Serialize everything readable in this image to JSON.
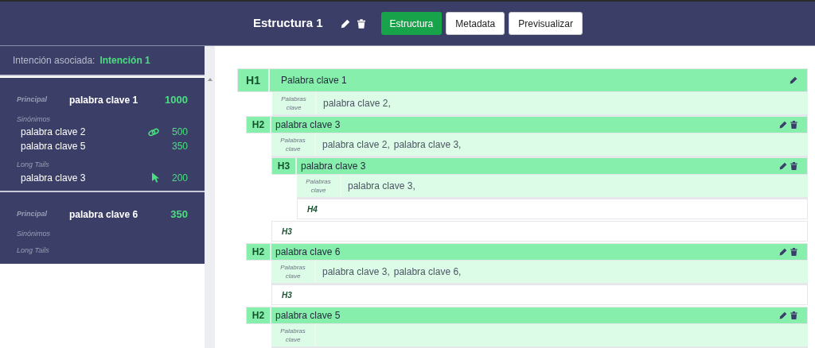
{
  "header": {
    "title": "Estructura 1",
    "tabs": [
      {
        "label": "Estructura",
        "selected": true
      },
      {
        "label": "Metadata",
        "selected": false
      },
      {
        "label": "Previsualizar",
        "selected": false
      }
    ]
  },
  "sidebar": {
    "intent_label": "Intención asociada:",
    "intent": "Intención 1",
    "groups": [
      {
        "principal_label": "Principal",
        "principal": "palabra clave 1",
        "volume": "1000",
        "synonyms_label": "Sinónimos",
        "synonyms": [
          {
            "text": "palabra clave 2",
            "volume": "500",
            "kind": "linked"
          },
          {
            "text": "palabra clave 5",
            "volume": "350",
            "kind": "plain"
          }
        ],
        "long_tails_label": "Long Tails",
        "long_tails": [
          {
            "text": "palabra clave 3",
            "volume": "200",
            "kind": "pointer"
          }
        ]
      },
      {
        "principal_label": "Principal",
        "principal": "palabra clave 6",
        "volume": "350",
        "synonyms_label": "Sinónimos",
        "long_tails_label": "Long Tails"
      }
    ]
  },
  "structure": [
    {
      "kind": "section",
      "level": "H1",
      "title": "Palabra clave 1",
      "deletable": false,
      "keywords_label": "Palabras clave",
      "keywords": [
        "palabra clave 2,"
      ],
      "children": [
        {
          "kind": "section",
          "level": "H2",
          "title": "palabra clave 3",
          "deletable": true,
          "keywords_label": "Palabras clave",
          "keywords": [
            "palabra clave 2,",
            "palabra clave 3,"
          ],
          "children": [
            {
              "kind": "section",
              "level": "H3",
              "title": "palabra clave 3",
              "deletable": true,
              "keywords_label": "Palabras clave",
              "keywords": [
                "palabra clave 3,"
              ],
              "children": [
                {
                  "kind": "empty",
                  "level": "H4"
                }
              ]
            },
            {
              "kind": "empty",
              "level": "H3"
            }
          ]
        },
        {
          "kind": "section",
          "level": "H2",
          "title": "palabra clave 6",
          "deletable": true,
          "keywords_label": "Palabras clave",
          "keywords": [
            "palabra clave 3,",
            "palabra clave 6,"
          ],
          "children": [
            {
              "kind": "empty",
              "level": "H3"
            }
          ]
        },
        {
          "kind": "section",
          "level": "H2",
          "title": "palabra clave 5",
          "deletable": true,
          "keywords_label": "Palabras clave"
        }
      ]
    }
  ]
}
